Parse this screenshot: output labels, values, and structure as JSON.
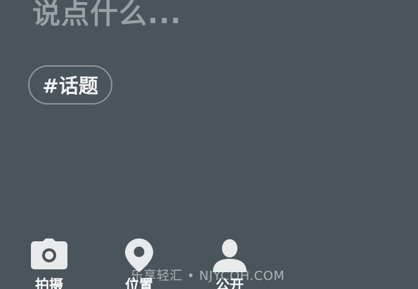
{
  "compose": {
    "placeholder": "说点什么..."
  },
  "topic_button": {
    "label": "#话题"
  },
  "toolbar": {
    "items": [
      {
        "icon": "camera-icon",
        "label": "拍摄"
      },
      {
        "icon": "location-pin-icon",
        "label": "位置"
      },
      {
        "icon": "person-icon",
        "label": "公开"
      }
    ]
  },
  "watermark": "乐享轻汇 • NJYCQH.COM",
  "colors": {
    "background": "#4a545b",
    "placeholder": "#9aa1a5",
    "chip_border": "#8d9498",
    "icon": "#e8eaeb"
  }
}
